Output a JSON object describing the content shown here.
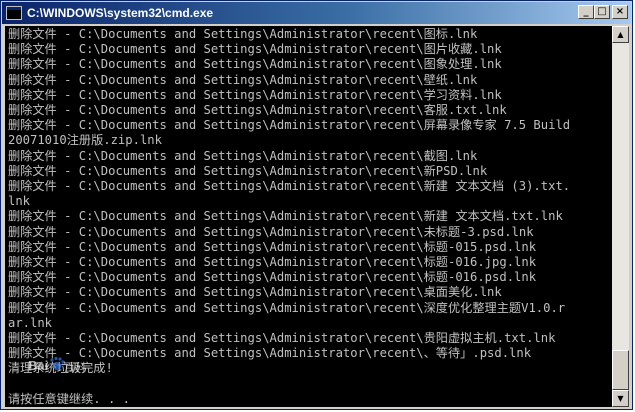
{
  "window": {
    "title": "C:\\WINDOWS\\system32\\cmd.exe",
    "minimize_glyph": "_",
    "maximize_glyph": "□",
    "close_glyph": "×"
  },
  "console": {
    "lines": [
      "删除文件 - C:\\Documents and Settings\\Administrator\\recent\\图标.lnk",
      "删除文件 - C:\\Documents and Settings\\Administrator\\recent\\图片收藏.lnk",
      "删除文件 - C:\\Documents and Settings\\Administrator\\recent\\图象处理.lnk",
      "删除文件 - C:\\Documents and Settings\\Administrator\\recent\\壁纸.lnk",
      "删除文件 - C:\\Documents and Settings\\Administrator\\recent\\学习资料.lnk",
      "删除文件 - C:\\Documents and Settings\\Administrator\\recent\\客服.txt.lnk",
      "删除文件 - C:\\Documents and Settings\\Administrator\\recent\\屏幕录像专家 7.5 Build",
      "20071010注册版.zip.lnk",
      "删除文件 - C:\\Documents and Settings\\Administrator\\recent\\截图.lnk",
      "删除文件 - C:\\Documents and Settings\\Administrator\\recent\\新PSD.lnk",
      "删除文件 - C:\\Documents and Settings\\Administrator\\recent\\新建 文本文档 (3).txt.",
      "lnk",
      "删除文件 - C:\\Documents and Settings\\Administrator\\recent\\新建 文本文档.txt.lnk",
      "删除文件 - C:\\Documents and Settings\\Administrator\\recent\\未标题-3.psd.lnk",
      "删除文件 - C:\\Documents and Settings\\Administrator\\recent\\标题-015.psd.lnk",
      "删除文件 - C:\\Documents and Settings\\Administrator\\recent\\标题-016.jpg.lnk",
      "删除文件 - C:\\Documents and Settings\\Administrator\\recent\\标题-016.psd.lnk",
      "删除文件 - C:\\Documents and Settings\\Administrator\\recent\\桌面美化.lnk",
      "删除文件 - C:\\Documents and Settings\\Administrator\\recent\\深度优化整理主题V1.0.r",
      "ar.lnk",
      "删除文件 - C:\\Documents and Settings\\Administrator\\recent\\贵阳虚拟主机.txt.lnk",
      "删除文件 - C:\\Documents and Settings\\Administrator\\recent\\、等待」.psd.lnk",
      "清理系统垃圾完成!",
      "",
      "请按任意键继续. . ."
    ]
  },
  "watermark": {
    "brand_latin": "Bai",
    "brand_cjk": "百科"
  },
  "colors": {
    "console_bg": "#000000",
    "console_text": "#c0c0c0",
    "titlebar_start": "#0a246a",
    "titlebar_end": "#a6caf0"
  }
}
